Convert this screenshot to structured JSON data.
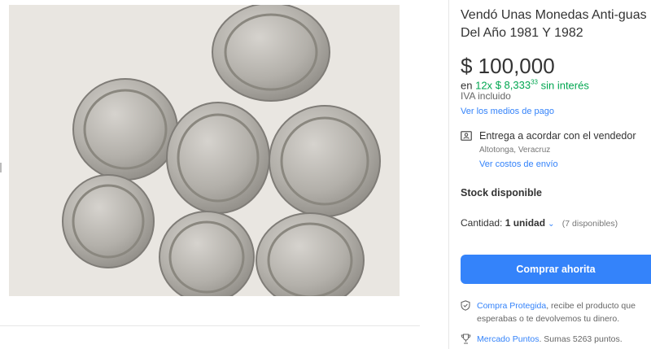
{
  "product": {
    "title": "Vendó Unas Monedas Anti-guas Del Año 1981 Y 1982",
    "image_alt": "coins-photo"
  },
  "price": {
    "main": "$ 100,000",
    "installments_prefix": "en",
    "installments_count": "12x",
    "installment_amount": "$ 8,333",
    "installment_cents": "33",
    "installments_suffix": "sin interés",
    "tax_note": "IVA incluido",
    "payment_methods_link": "Ver los medios de pago"
  },
  "delivery": {
    "label": "Entrega a acordar con el vendedor",
    "location": "Altotonga, Veracruz",
    "shipping_link": "Ver costos de envío"
  },
  "stock": {
    "label": "Stock disponible"
  },
  "quantity": {
    "label": "Cantidad:",
    "value": "1 unidad",
    "available": "(7 disponibles)"
  },
  "buy_button": {
    "label": "Comprar ahorita"
  },
  "protection": {
    "link": "Compra Protegida",
    "text": ", recibe el producto que esperabas o te devolvemos tu dinero."
  },
  "points": {
    "link": "Mercado Puntos",
    "text": ". Sumas 5263 puntos."
  },
  "colors": {
    "accent": "#3483fa",
    "green": "#00a650",
    "photo_bg": "#e9e6e1",
    "coin": "#b9b6b0"
  },
  "icons": {
    "delivery": "person-card-icon",
    "protection": "shield-icon",
    "points": "trophy-icon"
  }
}
